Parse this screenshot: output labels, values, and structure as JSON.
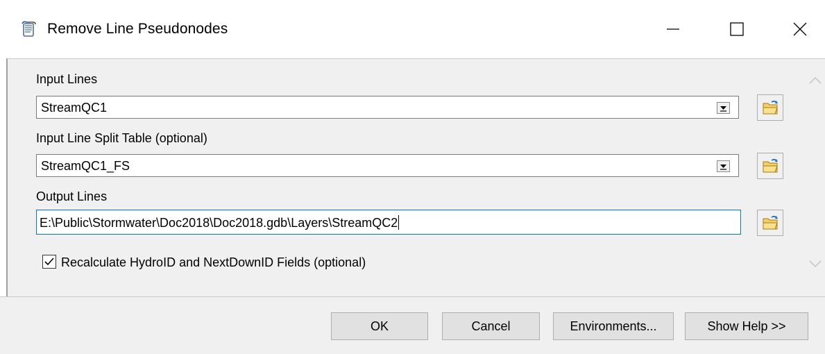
{
  "window": {
    "title": "Remove Line Pseudonodes"
  },
  "form": {
    "input_lines": {
      "label": "Input Lines",
      "value": "StreamQC1"
    },
    "split_table": {
      "label": "Input Line Split Table (optional)",
      "value": "StreamQC1_FS"
    },
    "output_lines": {
      "label": "Output Lines",
      "value": "E:\\Public\\Stormwater\\Doc2018\\Doc2018.gdb\\Layers\\StreamQC2"
    },
    "recalc": {
      "label": "Recalculate HydroID and NextDownID Fields (optional)",
      "checked": true
    }
  },
  "buttons": {
    "ok": "OK",
    "cancel": "Cancel",
    "environments": "Environments...",
    "show_help": "Show Help >>"
  },
  "icons": {
    "app": "tool-script-icon",
    "browse": "open-folder-icon"
  }
}
